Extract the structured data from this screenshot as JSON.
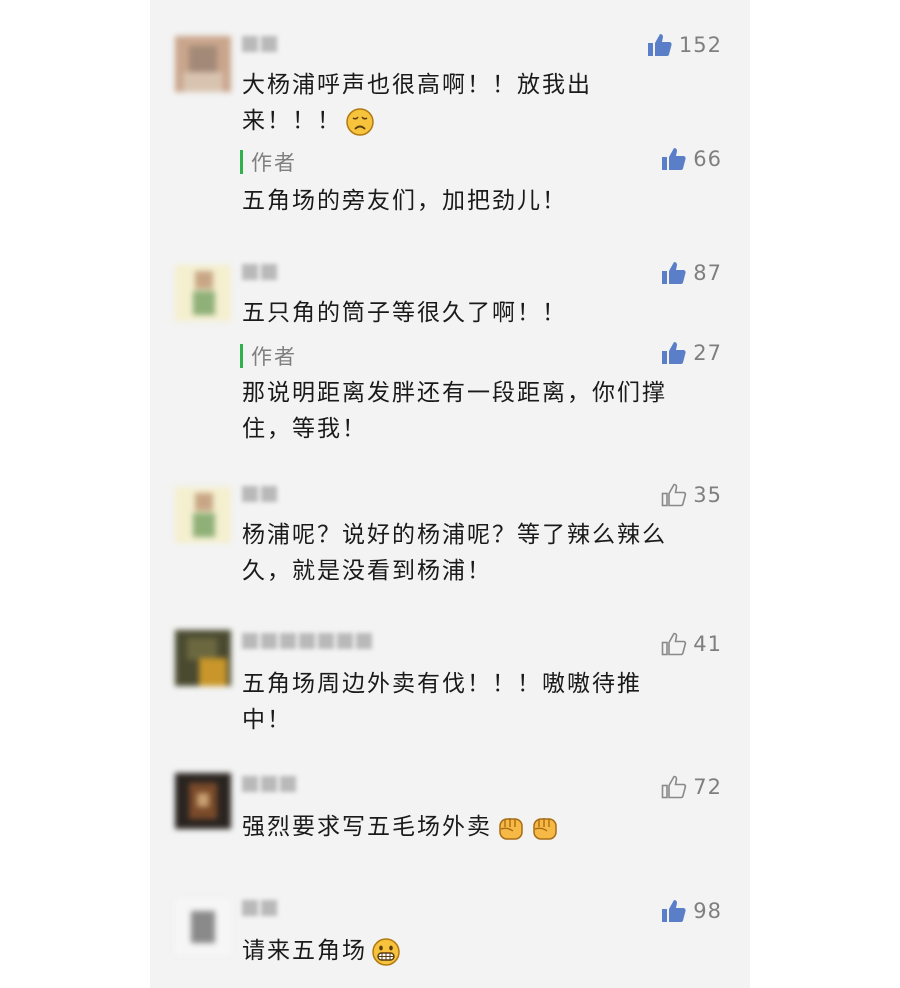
{
  "comments": [
    {
      "likes": "152",
      "text": "大杨浦呼声也很高啊！！放我出\n来！！！",
      "reply": {
        "label": "作者",
        "likes": "66",
        "text": "五角场的旁友们，加把劲儿！"
      }
    },
    {
      "likes": "87",
      "text": "五只角的筒子等很久了啊！！",
      "reply": {
        "label": "作者",
        "likes": "27",
        "text": "那说明距离发胖还有一段距离，你们撑\n住，等我！"
      }
    },
    {
      "likes": "35",
      "text": "杨浦呢？说好的杨浦呢？等了辣么辣么\n久，就是没看到杨浦！"
    },
    {
      "likes": "41",
      "text": "五角场周边外卖有伐！！！嗷嗷待推\n中！"
    },
    {
      "likes": "72",
      "text": "强烈要求写五毛场外卖"
    },
    {
      "likes": "98",
      "text": "请来五角场"
    }
  ],
  "colors": {
    "author_bar": "#2fb24d",
    "like_filled": "#5b7ec8",
    "like_outline": "#8a8a8a",
    "emoji": "#f7c23c"
  },
  "icons": {
    "like_filled": "thumbs-up-filled-icon",
    "like_outline": "thumbs-up-outline-icon"
  }
}
